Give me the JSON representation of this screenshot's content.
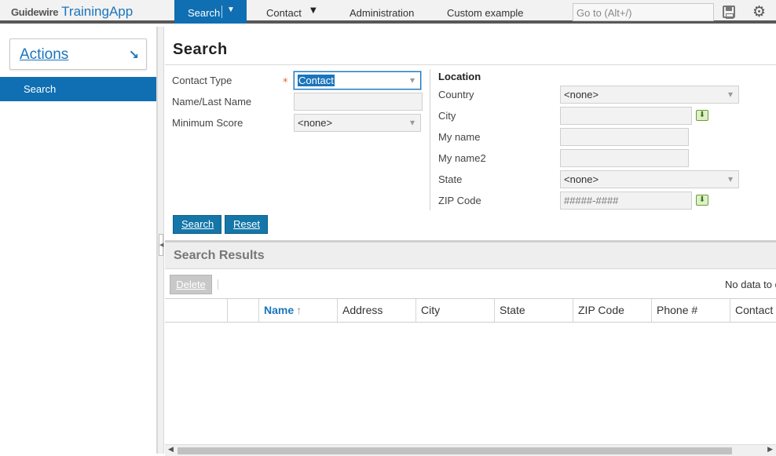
{
  "app": {
    "brand": "Guidewire",
    "name": "TrainingApp"
  },
  "topnav": {
    "search": "Search",
    "contact": "Contact",
    "administration": "Administration",
    "custom_example": "Custom example",
    "goto_placeholder": "Go to (Alt+/)"
  },
  "icons": {
    "save": "save-icon",
    "settings": "gear-icon",
    "actions_arrow": "arrow-down-right-icon",
    "lookup": "download-arrow-icon",
    "sort": "sort-up-icon"
  },
  "sidebar": {
    "actions_label": "Actions",
    "items": [
      {
        "label": "Search",
        "selected": true
      }
    ]
  },
  "page": {
    "title": "Search"
  },
  "form": {
    "contact_type_label": "Contact Type",
    "contact_type_value": "Contact",
    "name_label": "Name/Last Name",
    "name_value": "",
    "min_score_label": "Minimum Score",
    "min_score_value": "<none>",
    "location": {
      "heading": "Location",
      "country_label": "Country",
      "country_value": "<none>",
      "city_label": "City",
      "city_value": "",
      "my_name_label": "My name",
      "my_name2_label": "My name2",
      "state_label": "State",
      "state_value": "<none>",
      "zip_label": "ZIP Code",
      "zip_placeholder": "#####-####"
    },
    "search_button": "Search",
    "reset_button": "Reset"
  },
  "results": {
    "title": "Search Results",
    "delete_button": "Delete",
    "no_data": "No data to d",
    "columns": [
      "",
      "",
      "Name",
      "Address",
      "City",
      "State",
      "ZIP Code",
      "Phone #",
      "Contact T"
    ]
  },
  "colors": {
    "accent": "#0f6fb2",
    "required": "#e06c1e",
    "link": "#1b75bc"
  }
}
